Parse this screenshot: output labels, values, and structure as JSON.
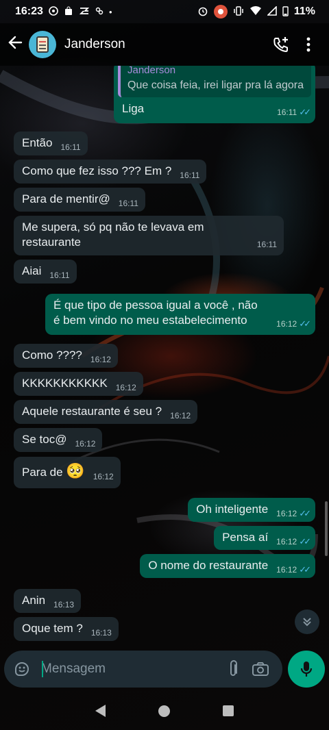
{
  "status_bar": {
    "time": "16:23",
    "battery": "11%",
    "left_icons": [
      "whatsapp-notif-icon",
      "shopping-bag-icon",
      "sync-icon",
      "app-icon",
      "dot-icon"
    ],
    "right_icons": [
      "alarm-icon",
      "recording-icon",
      "vibrate-icon",
      "wifi-icon",
      "signal-icon",
      "battery-icon"
    ]
  },
  "header": {
    "contact_name": "Janderson"
  },
  "messages": [
    {
      "id": 0,
      "dir": "out",
      "quote_author": "Janderson",
      "quote_text": "Que coisa feia, irei ligar pra lá agora",
      "text": "Liga",
      "time": "16:11",
      "ticks": "✓✓"
    },
    {
      "id": 1,
      "dir": "in",
      "text": "Então",
      "time": "16:11"
    },
    {
      "id": 2,
      "dir": "in",
      "text": "Como que fez isso ??? Em ?",
      "time": "16:11"
    },
    {
      "id": 3,
      "dir": "in",
      "text": "Para de mentir@",
      "time": "16:11"
    },
    {
      "id": 4,
      "dir": "in",
      "text": "Me supera, só pq não te levava em restaurante",
      "time": "16:11"
    },
    {
      "id": 5,
      "dir": "in",
      "text": "Aiai",
      "time": "16:11"
    },
    {
      "id": 6,
      "dir": "out",
      "text": "É que tipo de pessoa igual a você , não é bem vindo no meu estabelecimento",
      "time": "16:12",
      "ticks": "✓✓"
    },
    {
      "id": 7,
      "dir": "in",
      "text": "Como ????",
      "time": "16:12"
    },
    {
      "id": 8,
      "dir": "in",
      "text": "KKKKKKKKKKK",
      "time": "16:12"
    },
    {
      "id": 9,
      "dir": "in",
      "text": "Aquele restaurante é seu ?",
      "time": "16:12"
    },
    {
      "id": 10,
      "dir": "in",
      "text": "Se toc@",
      "time": "16:12"
    },
    {
      "id": 11,
      "dir": "in",
      "text": "Para de",
      "emoji": "🥺",
      "time": "16:12"
    },
    {
      "id": 12,
      "dir": "out",
      "text": "Oh inteligente",
      "time": "16:12",
      "ticks": "✓✓"
    },
    {
      "id": 13,
      "dir": "out",
      "text": "Pensa aí",
      "time": "16:12",
      "ticks": "✓✓"
    },
    {
      "id": 14,
      "dir": "out",
      "text": "O nome do restaurante",
      "time": "16:12",
      "ticks": "✓✓"
    },
    {
      "id": 15,
      "dir": "in",
      "text": "Anin",
      "time": "16:13"
    },
    {
      "id": 16,
      "dir": "in",
      "text": "Oque tem ?",
      "time": "16:13"
    }
  ],
  "composer": {
    "placeholder": "Mensagem"
  },
  "colors": {
    "incoming_bubble": "#1f292f",
    "outgoing_bubble": "#005c4b",
    "accent": "#00a884",
    "read_ticks": "#53bdeb",
    "quote_author": "#a78bda"
  }
}
